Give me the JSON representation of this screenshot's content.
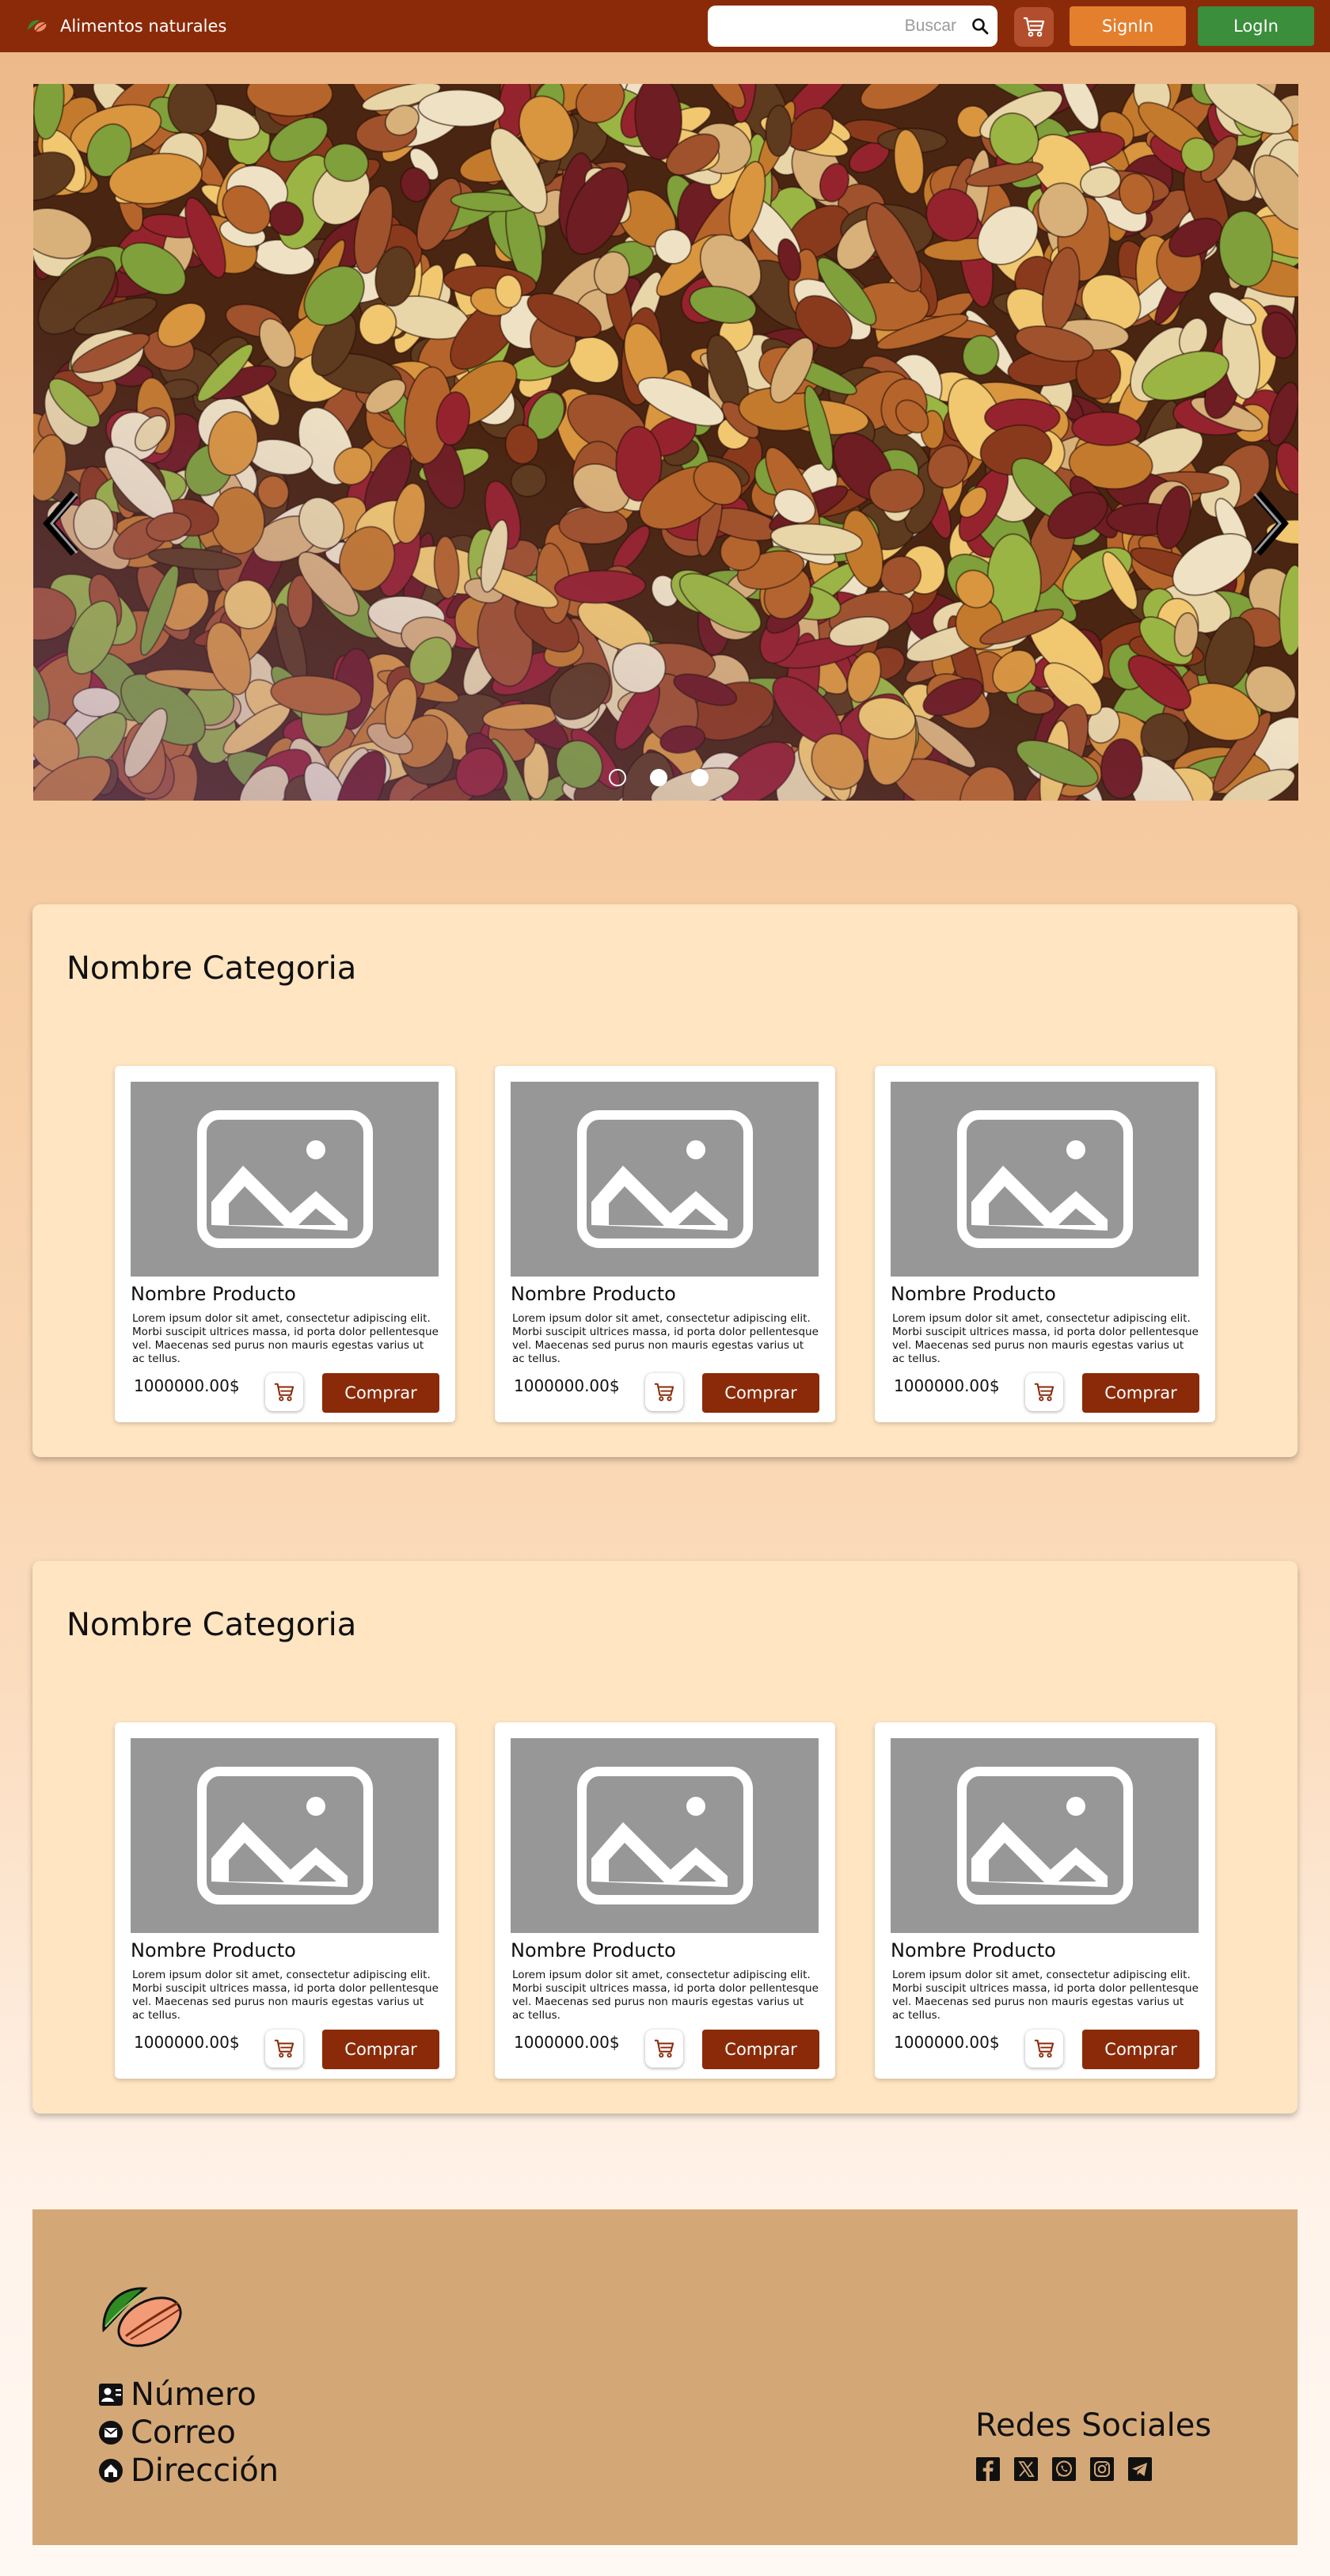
{
  "header": {
    "brand_name": "Alimentos naturales",
    "search_placeholder": "Buscar",
    "signin_label": "SignIn",
    "login_label": "LogIn"
  },
  "carousel": {
    "slides": 3,
    "active_slide": 1
  },
  "categories": [
    {
      "title": "Nombre Categoria",
      "products": [
        {
          "name": "Nombre Producto",
          "description": "Lorem ipsum dolor sit amet, consectetur adipiscing elit. Morbi suscipit ultrices massa, id porta dolor pellentesque vel. Maecenas sed purus non mauris egestas varius ut ac tellus.",
          "price": "1000000.00$",
          "buy_label": "Comprar"
        },
        {
          "name": "Nombre Producto",
          "description": "Lorem ipsum dolor sit amet, consectetur adipiscing elit. Morbi suscipit ultrices massa, id porta dolor pellentesque vel. Maecenas sed purus non mauris egestas varius ut ac tellus.",
          "price": "1000000.00$",
          "buy_label": "Comprar"
        },
        {
          "name": "Nombre Producto",
          "description": "Lorem ipsum dolor sit amet, consectetur adipiscing elit. Morbi suscipit ultrices massa, id porta dolor pellentesque vel. Maecenas sed purus non mauris egestas varius ut ac tellus.",
          "price": "1000000.00$",
          "buy_label": "Comprar"
        }
      ]
    },
    {
      "title": "Nombre Categoria",
      "products": [
        {
          "name": "Nombre Producto",
          "description": "Lorem ipsum dolor sit amet, consectetur adipiscing elit. Morbi suscipit ultrices massa, id porta dolor pellentesque vel. Maecenas sed purus non mauris egestas varius ut ac tellus.",
          "price": "1000000.00$",
          "buy_label": "Comprar"
        },
        {
          "name": "Nombre Producto",
          "description": "Lorem ipsum dolor sit amet, consectetur adipiscing elit. Morbi suscipit ultrices massa, id porta dolor pellentesque vel. Maecenas sed purus non mauris egestas varius ut ac tellus.",
          "price": "1000000.00$",
          "buy_label": "Comprar"
        },
        {
          "name": "Nombre Producto",
          "description": "Lorem ipsum dolor sit amet, consectetur adipiscing elit. Morbi suscipit ultrices massa, id porta dolor pellentesque vel. Maecenas sed purus non mauris egestas varius ut ac tellus.",
          "price": "1000000.00$",
          "buy_label": "Comprar"
        }
      ]
    }
  ],
  "footer": {
    "contact": [
      {
        "icon": "contact-card-icon",
        "label": "Número"
      },
      {
        "icon": "mail-icon",
        "label": "Correo"
      },
      {
        "icon": "home-icon",
        "label": "Dirección"
      }
    ],
    "social_title": "Redes Sociales",
    "social_icons": [
      "facebook-icon",
      "x-icon",
      "whatsapp-icon",
      "instagram-icon",
      "telegram-icon"
    ]
  },
  "colors": {
    "header_bg": "#8b2a09",
    "signin_bg": "#e47f2d",
    "login_bg": "#3b8e3b",
    "buy_bg": "#8b2a09",
    "category_bg": "#ffe5c1",
    "footer_bg": "#d4a876"
  }
}
